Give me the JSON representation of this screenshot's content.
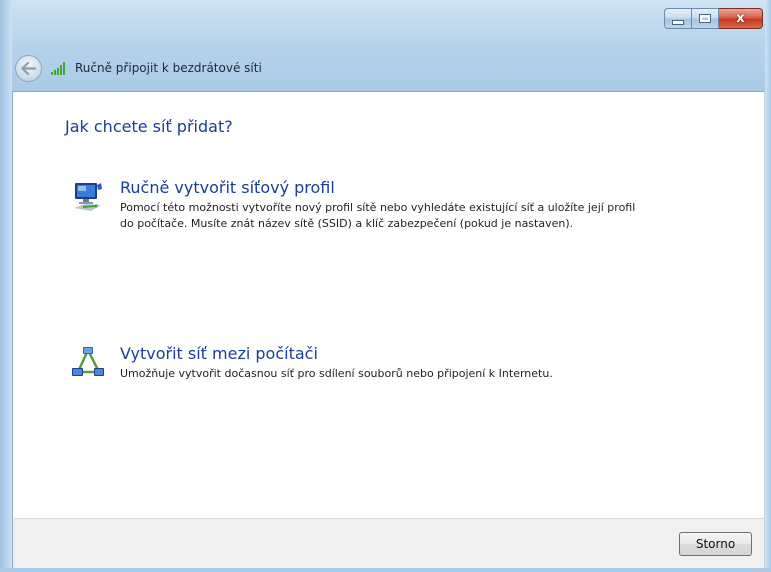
{
  "window": {
    "title": "Ručně připojit k bezdrátové síti",
    "caption": {
      "close_glyph": "x"
    }
  },
  "content": {
    "question": "Jak chcete síť přidat?",
    "options": [
      {
        "icon": "network-profile-icon",
        "title": "Ručně vytvořit síťový profil",
        "description": "Pomocí této možnosti vytvoříte nový profil sítě nebo vyhledáte existující síť a uložíte její profil do počítače. Musíte znát název sítě (SSID) a klíč zabezpečení (pokud je nastaven)."
      },
      {
        "icon": "adhoc-network-icon",
        "title": "Vytvořit síť mezi počítači",
        "description": "Umožňuje vytvořit dočasnou síť pro sdílení souborů nebo připojení k Internetu."
      }
    ]
  },
  "footer": {
    "cancel_label": "Storno"
  },
  "colors": {
    "link_blue": "#1a3d99",
    "close_red": "#c7361c",
    "glass": "#b6d3ec"
  }
}
